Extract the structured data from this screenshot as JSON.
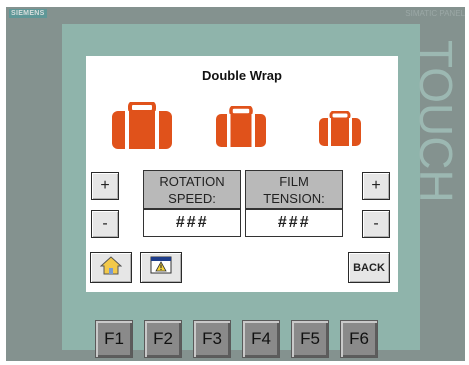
{
  "device": {
    "brand": "SIEMENS",
    "model": "SIMATIC PANEL",
    "touch_label": "TOUCH"
  },
  "screen": {
    "title": "Double Wrap",
    "rotation": {
      "label_line1": "ROTATION",
      "label_line2": "SPEED:",
      "value": "###",
      "plus": "+",
      "minus": "-"
    },
    "film": {
      "label_line1": "FILM",
      "label_line2": "TENSION:",
      "value": "###",
      "plus": "+",
      "minus": "-"
    },
    "back_label": "BACK"
  },
  "function_keys": [
    "F1",
    "F2",
    "F3",
    "F4",
    "F5",
    "F6"
  ],
  "colors": {
    "bag": "#e0521b",
    "panel": "#84928f",
    "bezel": "#8fb4ab"
  }
}
